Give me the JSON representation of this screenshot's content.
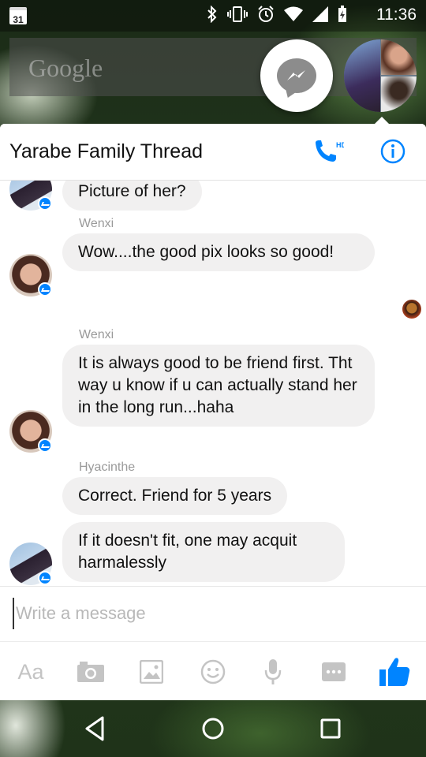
{
  "status_bar": {
    "calendar_day": "31",
    "time": "11:36",
    "icons": [
      "bluetooth-icon",
      "vibrate-icon",
      "alarm-icon",
      "wifi-icon",
      "signal-icon",
      "battery-charging-icon"
    ]
  },
  "google_bar": {
    "logo_text": "Google"
  },
  "chat_heads": {
    "messenger_icon": "messenger-icon",
    "group_avatar": "group-thread-avatar"
  },
  "thread": {
    "title": "Yarabe Family Thread",
    "hd_call_icon": "hd-call-icon",
    "hd_label": "HD",
    "info_icon": "info-icon",
    "accent_color": "#0084ff"
  },
  "messages": {
    "m0": {
      "text": "Picture of her?"
    },
    "g1": {
      "sender": "Wenxi"
    },
    "m1": {
      "text": "Wow....the good pix looks so good!"
    },
    "g2": {
      "sender": "Wenxi"
    },
    "m2": {
      "text": "It is always good to be friend first. Tht way u know if u can actually stand her in the long run...haha"
    },
    "g3": {
      "sender": "Hyacinthe"
    },
    "m3": {
      "text": "Correct. Friend for 5 years"
    },
    "m4": {
      "text": "If it doesn't fit, one may acquit harmalessly"
    }
  },
  "composer": {
    "placeholder": "Write a message",
    "value": ""
  },
  "toolbar": {
    "text_format_label": "Aa",
    "icons": [
      "camera-icon",
      "gallery-icon",
      "emoji-icon",
      "microphone-icon",
      "more-icon",
      "like-icon"
    ]
  },
  "nav": {
    "icons": [
      "back-icon",
      "home-icon",
      "recents-icon"
    ]
  }
}
